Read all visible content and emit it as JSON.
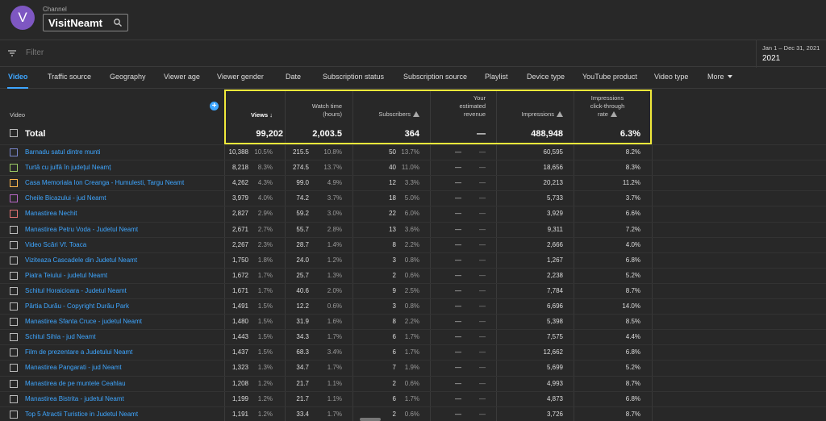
{
  "channel": {
    "avatar_letter": "V",
    "label": "Channel",
    "name": "VisitNeamt"
  },
  "filter": {
    "placeholder": "Filter"
  },
  "date": {
    "range": "Jan 1 – Dec 31, 2021",
    "year": "2021"
  },
  "tabs": [
    "Video",
    "Traffic source",
    "Geography",
    "Viewer age",
    "Viewer gender",
    "Date",
    "Subscription status",
    "Subscription source",
    "Playlist",
    "Device type",
    "YouTube product",
    "Video type",
    "More"
  ],
  "columns": {
    "video": "Video",
    "views": "Views",
    "watch_time_1": "Watch time",
    "watch_time_2": "(hours)",
    "subscribers": "Subscribers",
    "revenue_1": "Your",
    "revenue_2": "estimated",
    "revenue_3": "revenue",
    "impressions": "Impressions",
    "ctr_1": "Impressions",
    "ctr_2": "click-through",
    "ctr_3": "rate"
  },
  "total": {
    "label": "Total",
    "views": "99,202",
    "watch": "2,003.5",
    "subs": "364",
    "revenue": "—",
    "impressions": "488,948",
    "ctr": "6.3%"
  },
  "rows": [
    {
      "title": "Barnadu satul dintre munti",
      "views": "10,388",
      "views_pct": "10.5%",
      "watch": "215.5",
      "watch_pct": "10.8%",
      "subs": "50",
      "subs_pct": "13.7%",
      "rev": "—",
      "rev_pct": "—",
      "imp": "60,595",
      "ctr": "8.2%"
    },
    {
      "title": "Turtă cu julfă în județul Neamț",
      "views": "8,218",
      "views_pct": "8.3%",
      "watch": "274.5",
      "watch_pct": "13.7%",
      "subs": "40",
      "subs_pct": "11.0%",
      "rev": "—",
      "rev_pct": "—",
      "imp": "18,656",
      "ctr": "8.3%"
    },
    {
      "title": "Casa Memoriala Ion Creanga - Humulesti, Targu Neamt",
      "views": "4,262",
      "views_pct": "4.3%",
      "watch": "99.0",
      "watch_pct": "4.9%",
      "subs": "12",
      "subs_pct": "3.3%",
      "rev": "—",
      "rev_pct": "—",
      "imp": "20,213",
      "ctr": "11.2%"
    },
    {
      "title": "Cheile Bicazului - jud Neamt",
      "views": "3,979",
      "views_pct": "4.0%",
      "watch": "74.2",
      "watch_pct": "3.7%",
      "subs": "18",
      "subs_pct": "5.0%",
      "rev": "—",
      "rev_pct": "—",
      "imp": "5,733",
      "ctr": "3.7%"
    },
    {
      "title": "Manastirea Nechit",
      "views": "2,827",
      "views_pct": "2.9%",
      "watch": "59.2",
      "watch_pct": "3.0%",
      "subs": "22",
      "subs_pct": "6.0%",
      "rev": "—",
      "rev_pct": "—",
      "imp": "3,929",
      "ctr": "6.6%"
    },
    {
      "title": "Manastirea Petru Voda - Judetul Neamt",
      "views": "2,671",
      "views_pct": "2.7%",
      "watch": "55.7",
      "watch_pct": "2.8%",
      "subs": "13",
      "subs_pct": "3.6%",
      "rev": "—",
      "rev_pct": "—",
      "imp": "9,311",
      "ctr": "7.2%"
    },
    {
      "title": "Video Scări Vf. Toaca",
      "views": "2,267",
      "views_pct": "2.3%",
      "watch": "28.7",
      "watch_pct": "1.4%",
      "subs": "8",
      "subs_pct": "2.2%",
      "rev": "—",
      "rev_pct": "—",
      "imp": "2,666",
      "ctr": "4.0%"
    },
    {
      "title": "Viziteaza Cascadele din Judetul Neamt",
      "views": "1,750",
      "views_pct": "1.8%",
      "watch": "24.0",
      "watch_pct": "1.2%",
      "subs": "3",
      "subs_pct": "0.8%",
      "rev": "—",
      "rev_pct": "—",
      "imp": "1,267",
      "ctr": "6.8%"
    },
    {
      "title": "Piatra Teiului - judetul Neamt",
      "views": "1,672",
      "views_pct": "1.7%",
      "watch": "25.7",
      "watch_pct": "1.3%",
      "subs": "2",
      "subs_pct": "0.6%",
      "rev": "—",
      "rev_pct": "—",
      "imp": "2,238",
      "ctr": "5.2%"
    },
    {
      "title": "Schitul Horaicioara - Judetul Neamt",
      "views": "1,671",
      "views_pct": "1.7%",
      "watch": "40.6",
      "watch_pct": "2.0%",
      "subs": "9",
      "subs_pct": "2.5%",
      "rev": "—",
      "rev_pct": "—",
      "imp": "7,784",
      "ctr": "8.7%"
    },
    {
      "title": "Pârtia Durău - Copyright Durău Park",
      "views": "1,491",
      "views_pct": "1.5%",
      "watch": "12.2",
      "watch_pct": "0.6%",
      "subs": "3",
      "subs_pct": "0.8%",
      "rev": "—",
      "rev_pct": "—",
      "imp": "6,696",
      "ctr": "14.0%"
    },
    {
      "title": "Manastirea Sfanta Cruce - judetul Neamt",
      "views": "1,480",
      "views_pct": "1.5%",
      "watch": "31.9",
      "watch_pct": "1.6%",
      "subs": "8",
      "subs_pct": "2.2%",
      "rev": "—",
      "rev_pct": "—",
      "imp": "5,398",
      "ctr": "8.5%"
    },
    {
      "title": "Schitul Sihla - jud Neamt",
      "views": "1,443",
      "views_pct": "1.5%",
      "watch": "34.3",
      "watch_pct": "1.7%",
      "subs": "6",
      "subs_pct": "1.7%",
      "rev": "—",
      "rev_pct": "—",
      "imp": "7,575",
      "ctr": "4.4%"
    },
    {
      "title": "Film de prezentare a Judetului Neamt",
      "views": "1,437",
      "views_pct": "1.5%",
      "watch": "68.3",
      "watch_pct": "3.4%",
      "subs": "6",
      "subs_pct": "1.7%",
      "rev": "—",
      "rev_pct": "—",
      "imp": "12,662",
      "ctr": "6.8%"
    },
    {
      "title": "Manastirea Pangarati - jud Neamt",
      "views": "1,323",
      "views_pct": "1.3%",
      "watch": "34.7",
      "watch_pct": "1.7%",
      "subs": "7",
      "subs_pct": "1.9%",
      "rev": "—",
      "rev_pct": "—",
      "imp": "5,699",
      "ctr": "5.2%"
    },
    {
      "title": "Manastirea de pe muntele Ceahlau",
      "views": "1,208",
      "views_pct": "1.2%",
      "watch": "21.7",
      "watch_pct": "1.1%",
      "subs": "2",
      "subs_pct": "0.6%",
      "rev": "—",
      "rev_pct": "—",
      "imp": "4,993",
      "ctr": "8.7%"
    },
    {
      "title": "Manastirea Bistrita - judetul Neamt",
      "views": "1,199",
      "views_pct": "1.2%",
      "watch": "21.7",
      "watch_pct": "1.1%",
      "subs": "6",
      "subs_pct": "1.7%",
      "rev": "—",
      "rev_pct": "—",
      "imp": "4,873",
      "ctr": "6.8%"
    },
    {
      "title": "Top 5 Atractii Turistice in Judetul Neamt",
      "views": "1,191",
      "views_pct": "1.2%",
      "watch": "33.4",
      "watch_pct": "1.7%",
      "subs": "2",
      "subs_pct": "0.6%",
      "rev": "—",
      "rev_pct": "—",
      "imp": "3,726",
      "ctr": "8.7%"
    }
  ],
  "row_checkbox_colors": [
    "#7986cb",
    "#9ccc65",
    "#ffb74d",
    "#ba68c8",
    "#e57373"
  ],
  "colors": {
    "accent": "#3ea6ff",
    "highlight": "#f0e93a"
  }
}
